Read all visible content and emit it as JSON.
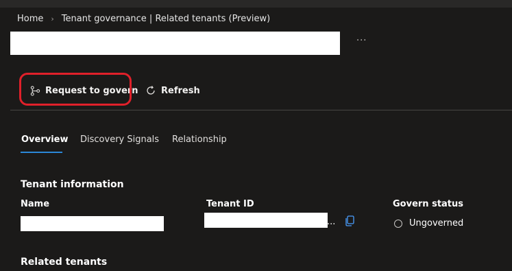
{
  "breadcrumb": {
    "home": "Home",
    "separator": "›",
    "current": "Tenant governance | Related tenants (Preview)"
  },
  "header": {
    "more_label": "···"
  },
  "toolbar": {
    "request_label": "Request to govern",
    "refresh_label": "Refresh"
  },
  "tabs": [
    {
      "label": "Overview",
      "active": true
    },
    {
      "label": "Discovery Signals",
      "active": false
    },
    {
      "label": "Relationship",
      "active": false
    }
  ],
  "tenant_info": {
    "title": "Tenant information",
    "name_label": "Name",
    "tenant_id_label": "Tenant ID",
    "tenant_id_ellipsis": "...",
    "govern_status_label": "Govern status",
    "govern_status_value": "Ungoverned"
  },
  "related": {
    "title": "Related tenants"
  },
  "colors": {
    "background": "#1b1a19",
    "accent": "#2b88d8",
    "highlight": "#e0202a",
    "copy_icon": "#4a9eff"
  }
}
